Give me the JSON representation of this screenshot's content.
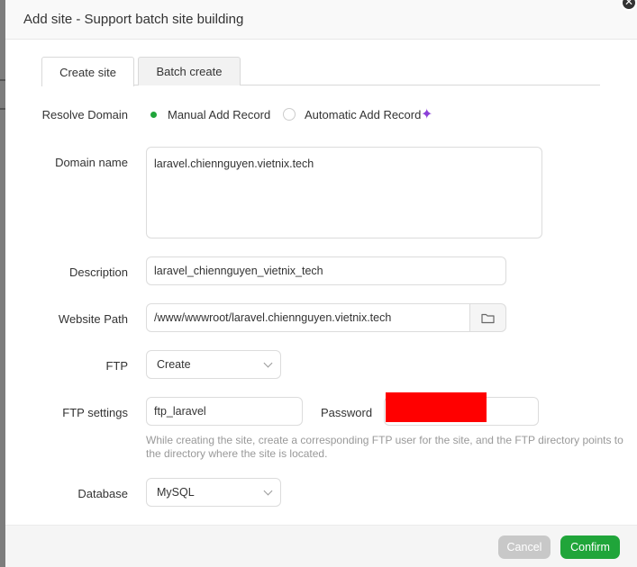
{
  "dialog": {
    "title": "Add site - Support batch site building",
    "close_glyph": "✕"
  },
  "tabs": [
    {
      "label": "Create site",
      "active": true
    },
    {
      "label": "Batch create",
      "active": false
    }
  ],
  "form": {
    "resolve_domain": {
      "label": "Resolve Domain",
      "options": [
        "Manual Add Record",
        "Automatic Add Record"
      ],
      "selected": "Manual Add Record",
      "sparkle_icon": "✦"
    },
    "domain_name": {
      "label": "Domain name",
      "value": "laravel.chiennguyen.vietnix.tech"
    },
    "description": {
      "label": "Description",
      "value": "laravel_chiennguyen_vietnix_tech"
    },
    "website_path": {
      "label": "Website Path",
      "value": "/www/wwwroot/laravel.chiennguyen.vietnix.tech",
      "button_icon": "folder-icon"
    },
    "ftp": {
      "label": "FTP",
      "selected": "Create"
    },
    "ftp_settings": {
      "label": "FTP settings",
      "username": "ftp_laravel",
      "password_label": "Password",
      "help": "While creating the site, create a corresponding FTP user for the site, and the FTP directory points to the directory where the site is located."
    },
    "database": {
      "label": "Database",
      "selected": "MySQL"
    }
  },
  "footer": {
    "cancel_label": "Cancel",
    "confirm_label": "Confirm"
  },
  "colors": {
    "accent": "#20a53a",
    "redaction": "#ff0000",
    "sparkle": "#8b3fd8"
  }
}
